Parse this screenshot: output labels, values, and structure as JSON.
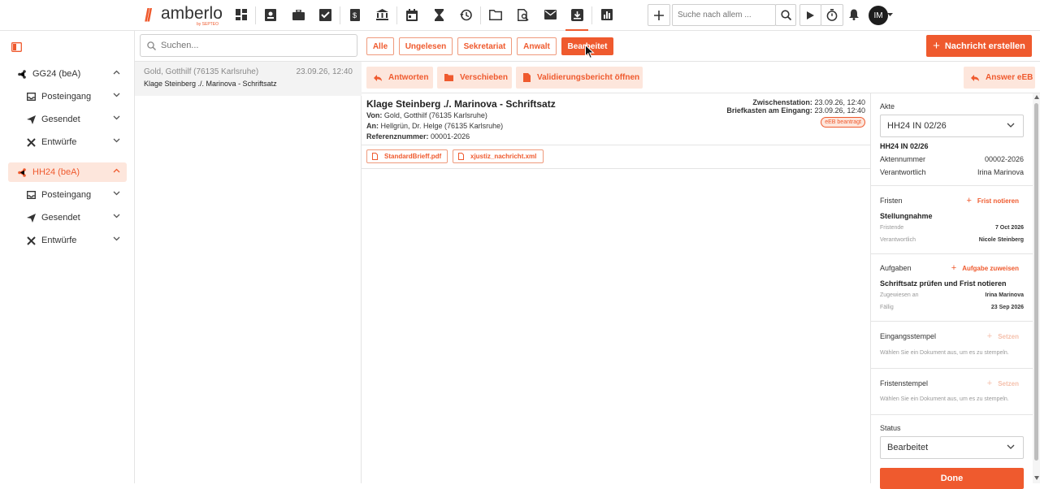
{
  "logo": {
    "name": "amberlo",
    "sub": "by SEPTEO"
  },
  "topbar": {
    "nav_icons": [
      "dashboard-icon",
      "contacts-icon",
      "briefcase-icon",
      "tasks-icon",
      "invoice-icon",
      "bank-icon",
      "calendar-icon",
      "hourglass-icon",
      "history-icon",
      "folder-icon",
      "document-search-icon",
      "mail-icon",
      "bea-inbox-icon",
      "reports-icon"
    ],
    "search_placeholder": "Suche nach allem ...",
    "avatar_initials": "IM"
  },
  "sidebar": {
    "groups": [
      {
        "label": "GG24 (beA)",
        "items": [
          "Posteingang",
          "Gesendet",
          "Entwürfe"
        ]
      },
      {
        "label": "HH24 (beA)",
        "items": [
          "Posteingang",
          "Gesendet",
          "Entwürfe"
        ]
      }
    ]
  },
  "filters": {
    "search_placeholder": "Suchen...",
    "chips": [
      "Alle",
      "Ungelesen",
      "Sekretariat",
      "Anwalt",
      "Bearbeitet"
    ],
    "active": "Bearbeitet",
    "create_label": "Nachricht erstellen"
  },
  "list": {
    "items": [
      {
        "from": "Gold, Gotthilf (76135 Karlsruhe)",
        "date": "23.09.26, 12:40",
        "subject": "Klage Steinberg ./. Marinova - Schriftsatz"
      }
    ]
  },
  "actions": {
    "reply": "Antworten",
    "move": "Verschieben",
    "validation": "Validierungsbericht öffnen",
    "answer_eeb": "Answer eEB"
  },
  "message": {
    "title": "Klage Steinberg ./. Marinova - Schriftsatz",
    "from_label": "Von:",
    "from": "Gold, Gotthilf (76135 Karlsruhe)",
    "to_label": "An:",
    "to": "Hellgrün, Dr. Helge (76135 Karlsruhe)",
    "ref_label": "Referenznummer:",
    "ref": "00001-2026",
    "zw_label": "Zwischenstation:",
    "zw": "23.09.26, 12:40",
    "bk_label": "Briefkasten am Eingang:",
    "bk": "23.09.26, 12:40",
    "badge": "eEB beantragt",
    "attachments": [
      "StandardBrieff.pdf",
      "xjustiz_nachricht.xml"
    ]
  },
  "panel": {
    "akte_label": "Akte",
    "akte_value": "HH24 IN 02/26",
    "akte_title": "HH24 IN 02/26",
    "aktennummer_label": "Aktennummer",
    "aktennummer": "00002-2026",
    "verantwortlich_label": "Verantwortlich",
    "verantwortlich": "Irina Marinova",
    "fristen_label": "Fristen",
    "frist_link": "Frist notieren",
    "frist_title": "Stellungnahme",
    "fristende_label": "Fristende",
    "fristende": "7 Oct 2026",
    "frist_verantw_label": "Verantwortlich",
    "frist_verantw": "Nicole Steinberg",
    "aufgaben_label": "Aufgaben",
    "aufgabe_link": "Aufgabe zuweisen",
    "aufgabe_title": "Schriftsatz prüfen und Frist notieren",
    "zugewiesen_label": "Zugewiesen an",
    "zugewiesen": "Irina Marinova",
    "faellig_label": "Fällig",
    "faellig": "23 Sep 2026",
    "eingang_label": "Eingangsstempel",
    "setzen": "Setzen",
    "eingang_hint": "Wählen Sie ein Dokument aus, um es zu stempeln.",
    "fristen_stempel_label": "Fristenstempel",
    "fristen_stempel_hint": "Wählen Sie ein Dokument aus, um es zu stempeln.",
    "status_label": "Status",
    "status_value": "Bearbeitet",
    "done": "Done"
  },
  "colors": {
    "accent": "#ef5a2e",
    "accent_light": "#fde6dc"
  }
}
